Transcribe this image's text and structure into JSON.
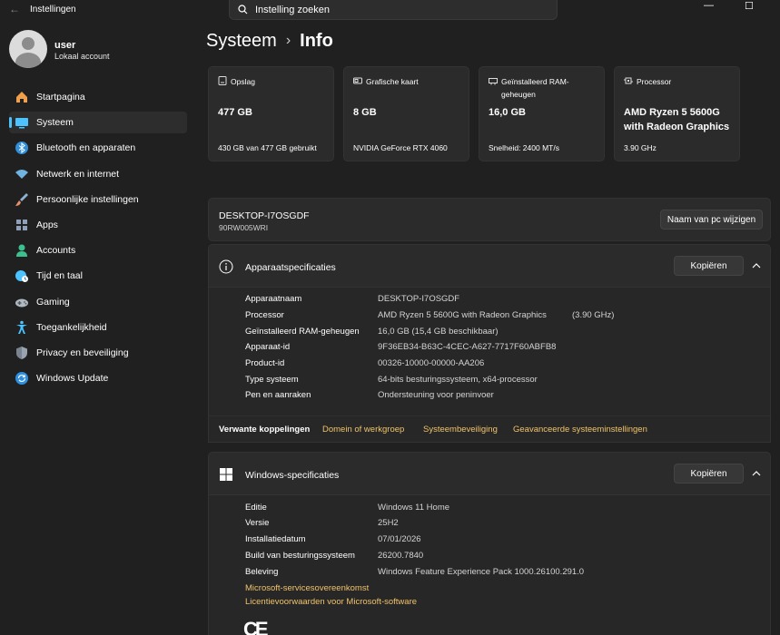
{
  "app": {
    "title": "Instellingen",
    "search_placeholder": "Instelling zoeken",
    "controls": {
      "minimize": "—",
      "maximize": "☐",
      "close": "✕"
    }
  },
  "user": {
    "name": "user",
    "account": "Lokaal account"
  },
  "sidebar": {
    "items": [
      {
        "label": "Startpagina",
        "icon": "home-icon",
        "color": "#f0a04b"
      },
      {
        "label": "Systeem",
        "icon": "monitor-icon",
        "color": "#4cc2ff",
        "active": true
      },
      {
        "label": "Bluetooth en apparaten",
        "icon": "bluetooth-icon",
        "color": "#4cc2ff"
      },
      {
        "label": "Netwerk en internet",
        "icon": "wifi-icon",
        "color": "#6fb3e0"
      },
      {
        "label": "Persoonlijke instellingen",
        "icon": "paintbrush-icon",
        "color": "#e8906a"
      },
      {
        "label": "Apps",
        "icon": "apps-icon",
        "color": "#8fa0b8"
      },
      {
        "label": "Accounts",
        "icon": "person-icon",
        "color": "#3cc08f"
      },
      {
        "label": "Tijd en taal",
        "icon": "globe-clock-icon",
        "color": "#4cc2ff"
      },
      {
        "label": "Gaming",
        "icon": "gamepad-icon",
        "color": "#b0b8c0"
      },
      {
        "label": "Toegankelijkheid",
        "icon": "accessibility-icon",
        "color": "#4cc2ff"
      },
      {
        "label": "Privacy en beveiliging",
        "icon": "shield-icon",
        "color": "#9aa4b0"
      },
      {
        "label": "Windows Update",
        "icon": "update-icon",
        "color": "#2e8fe0"
      }
    ]
  },
  "breadcrumb": {
    "parent": "Systeem",
    "separator": "›",
    "current": "Info"
  },
  "cards": [
    {
      "caption": "Opslag",
      "value": "477 GB",
      "sub": "430 GB van 477 GB gebruikt",
      "icon": "storage-icon"
    },
    {
      "caption": "Grafische kaart",
      "value": "8 GB",
      "sub": "NVIDIA GeForce RTX 4060",
      "icon": "gpu-icon"
    },
    {
      "caption": "Geïnstalleerd RAM-geheugen",
      "value": "16,0 GB",
      "sub": "Snelheid: 2400 MT/s",
      "icon": "ram-icon"
    },
    {
      "caption": "Processor",
      "value": "AMD Ryzen 5 5600G with Radeon Graphics",
      "sub": "3.90 GHz",
      "icon": "cpu-icon"
    }
  ],
  "pc": {
    "name": "DESKTOP-I7OSGDF",
    "model": "90RW005WRI",
    "rename_button": "Naam van pc wijzigen"
  },
  "device_specs": {
    "title": "Apparaatspecificaties",
    "copy_button": "Kopiëren",
    "rows": [
      {
        "key": "Apparaatnaam",
        "value": "DESKTOP-I7OSGDF"
      },
      {
        "key": "Processor",
        "value": "AMD Ryzen 5 5600G with Radeon Graphics",
        "extra": "(3.90 GHz)"
      },
      {
        "key": "Geïnstalleerd RAM-geheugen",
        "value": "16,0 GB (15,4 GB beschikbaar)"
      },
      {
        "key": "Apparaat-id",
        "value": "9F36EB34-B63C-4CEC-A627-7717F60ABFB8"
      },
      {
        "key": "Product-id",
        "value": "00326-10000-00000-AA206"
      },
      {
        "key": "Type systeem",
        "value": "64-bits besturingssysteem, x64-processor"
      },
      {
        "key": "Pen en aanraken",
        "value": "Ondersteuning voor peninvoer"
      }
    ]
  },
  "related": {
    "label": "Verwante koppelingen",
    "links": [
      "Domein of werkgroep",
      "Systeembeveiliging",
      "Geavanceerde systeeminstellingen"
    ]
  },
  "windows_specs": {
    "title": "Windows-specificaties",
    "copy_button": "Kopiëren",
    "rows": [
      {
        "key": "Editie",
        "value": "Windows 11 Home"
      },
      {
        "key": "Versie",
        "value": "25H2"
      },
      {
        "key": "Installatiedatum",
        "value": "07/01/2026"
      },
      {
        "key": "Build van besturingssysteem",
        "value": "26200.7840"
      },
      {
        "key": "Beleving",
        "value": "Windows Feature Experience Pack 1000.26100.291.0"
      }
    ],
    "links": [
      "Microsoft-servicesovereenkomst",
      "Licentievoorwaarden voor Microsoft-software"
    ]
  },
  "ce_mark": "CE",
  "colors": {
    "accent": "#4cc2ff",
    "link": "#f0c36b",
    "background": "#202020",
    "card": "#2b2b2b"
  }
}
